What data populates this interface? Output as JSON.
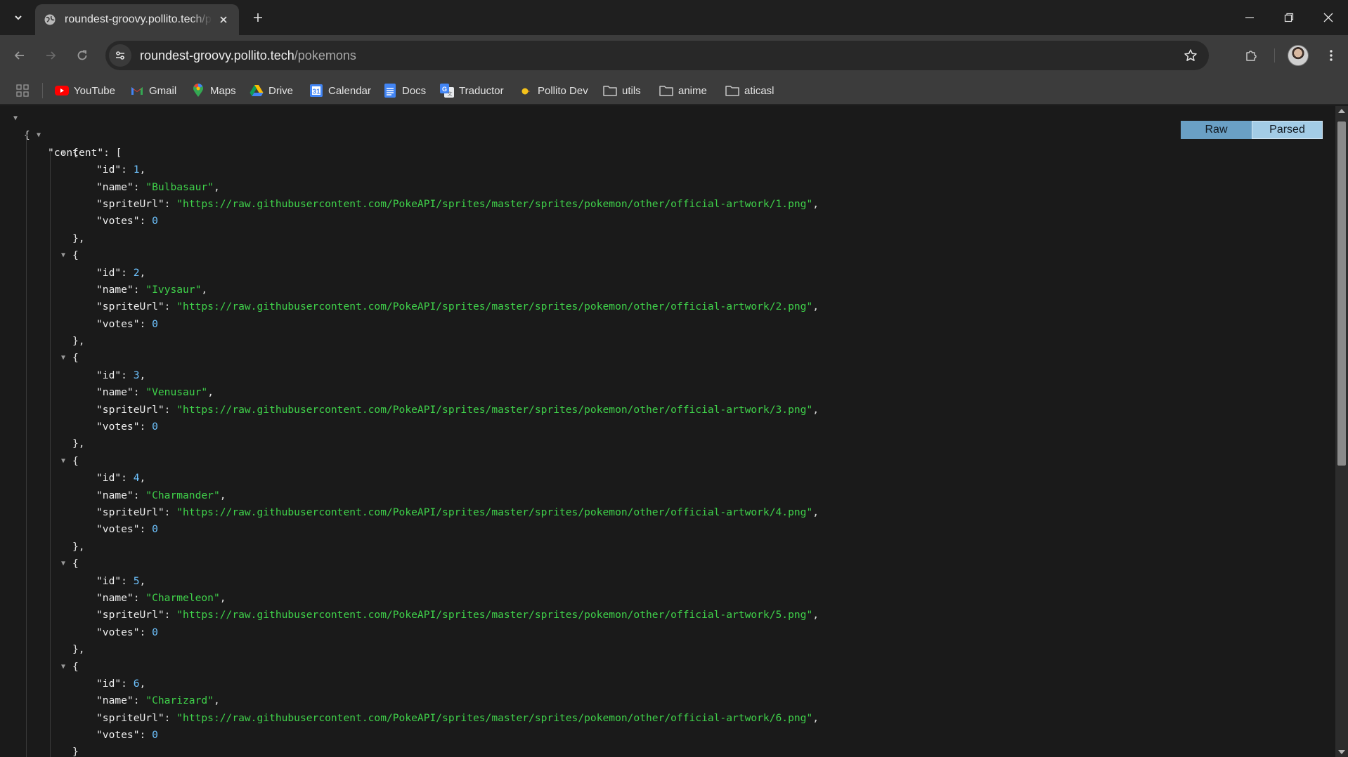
{
  "tab": {
    "title": "roundest-groovy.pollito.tech/pokemons",
    "icon": "globe-icon"
  },
  "omnibox": {
    "host": "roundest-groovy.pollito.tech",
    "path": "/pokemons"
  },
  "bookmarks": [
    {
      "label": "YouTube",
      "icon": "youtube-icon"
    },
    {
      "label": "Gmail",
      "icon": "gmail-icon"
    },
    {
      "label": "Maps",
      "icon": "maps-icon"
    },
    {
      "label": "Drive",
      "icon": "drive-icon"
    },
    {
      "label": "Calendar",
      "icon": "calendar-icon"
    },
    {
      "label": "Docs",
      "icon": "docs-icon"
    },
    {
      "label": "Traductor",
      "icon": "translate-icon"
    },
    {
      "label": "Pollito Dev",
      "icon": "pollito-icon"
    },
    {
      "label": "utils",
      "icon": "folder-icon"
    },
    {
      "label": "anime",
      "icon": "folder-icon"
    },
    {
      "label": "aticasl",
      "icon": "folder-icon"
    }
  ],
  "viewer": {
    "raw_label": "Raw",
    "parsed_label": "Parsed",
    "root_key": "content",
    "items": [
      {
        "id": "1",
        "name": "Bulbasaur",
        "spriteUrl": "https://raw.githubusercontent.com/PokeAPI/sprites/master/sprites/pokemon/other/official-artwork/1.png",
        "votes": "0"
      },
      {
        "id": "2",
        "name": "Ivysaur",
        "spriteUrl": "https://raw.githubusercontent.com/PokeAPI/sprites/master/sprites/pokemon/other/official-artwork/2.png",
        "votes": "0"
      },
      {
        "id": "3",
        "name": "Venusaur",
        "spriteUrl": "https://raw.githubusercontent.com/PokeAPI/sprites/master/sprites/pokemon/other/official-artwork/3.png",
        "votes": "0"
      },
      {
        "id": "4",
        "name": "Charmander",
        "spriteUrl": "https://raw.githubusercontent.com/PokeAPI/sprites/master/sprites/pokemon/other/official-artwork/4.png",
        "votes": "0"
      },
      {
        "id": "5",
        "name": "Charmeleon",
        "spriteUrl": "https://raw.githubusercontent.com/PokeAPI/sprites/master/sprites/pokemon/other/official-artwork/5.png",
        "votes": "0"
      },
      {
        "id": "6",
        "name": "Charizard",
        "spriteUrl": "https://raw.githubusercontent.com/PokeAPI/sprites/master/sprites/pokemon/other/official-artwork/6.png",
        "votes": "0"
      }
    ]
  },
  "colors": {
    "json_string": "#3fd14a",
    "json_number": "#6ec3ff",
    "toggle_raw": "#6aa0c5",
    "toggle_parsed": "#a3cce6"
  }
}
